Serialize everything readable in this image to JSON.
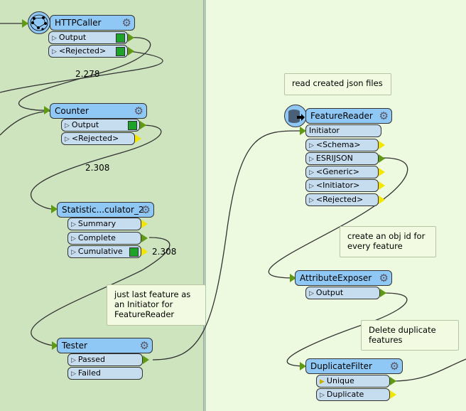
{
  "colors": {
    "bookmark_bg": "#cde4bf",
    "canvas_bg": "#eefadf",
    "transformer_header": "#8fc8f5",
    "port": "#c6dcef",
    "connected_port": "#5e9a12",
    "unconnected_port": "#f2e600"
  },
  "transformers": {
    "httpcaller": {
      "name": "HTTPCaller",
      "icon": "globe-network-icon",
      "ports": [
        "Output",
        "<Rejected>"
      ]
    },
    "counter": {
      "name": "Counter",
      "ports": [
        "Output",
        "<Rejected>"
      ]
    },
    "statistics": {
      "name": "Statistic...culator_2",
      "ports": [
        "Summary",
        "Complete",
        "Cumulative"
      ]
    },
    "tester": {
      "name": "Tester",
      "ports": [
        "Passed",
        "Failed"
      ]
    },
    "featurereader": {
      "name": "FeatureReader",
      "icon": "database-reader-icon",
      "input": "Initiator",
      "ports": [
        "<Schema>",
        "ESRIJSON",
        "<Generic>",
        "<Initiator>",
        "<Rejected>"
      ]
    },
    "attributeexposer": {
      "name": "AttributeExposer",
      "ports": [
        "Output"
      ]
    },
    "duplicatefilter": {
      "name": "DuplicateFilter",
      "ports": [
        "Unique",
        "Duplicate"
      ]
    }
  },
  "annotations": [
    "just last feature as an Initiator for FeatureReader",
    "read created json files",
    "create an obj id for every feature",
    "Delete duplicate features"
  ],
  "connection_labels": [
    "2.278",
    "2.308",
    "2.308"
  ]
}
